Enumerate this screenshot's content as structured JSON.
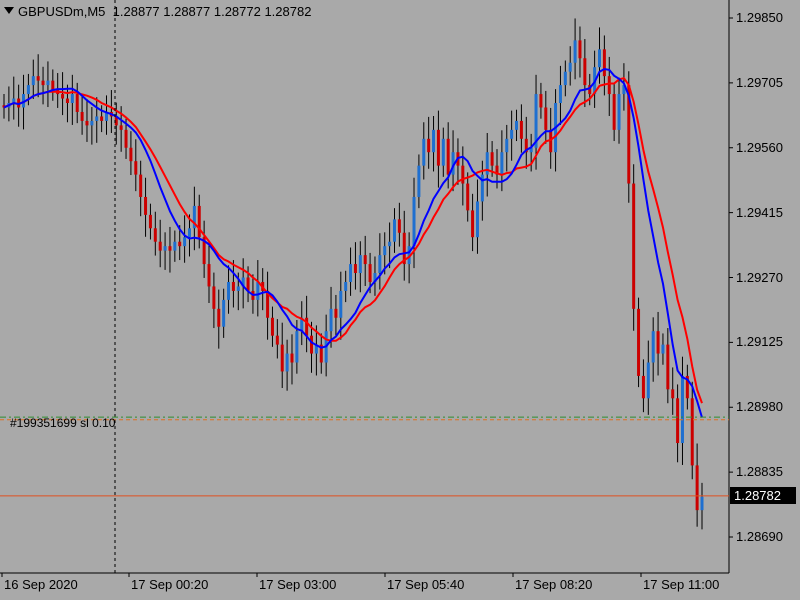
{
  "header": {
    "symbol": "GBPUSDm,M5",
    "ohlc": "1.28877 1.28877 1.28772 1.28782"
  },
  "order_label": "#199351699 sl 0.10",
  "order_label_shadow": "#199351699 sl",
  "current_price": "1.28782",
  "colors": {
    "background": "#a9a9a9",
    "bull_candle": "#1e6fd0",
    "bear_candle": "#cc0000",
    "wick": "#000000",
    "ma_fast": "#0000ff",
    "ma_slow": "#ff0000",
    "order_line_green": "#2f8f2f",
    "order_line_orange": "#e07020",
    "bid_line": "#e05020"
  },
  "chart_data": {
    "type": "candlestick",
    "title": "GBPUSDm,M5",
    "price_ticks": [
      "1.29850",
      "1.29705",
      "1.29560",
      "1.29415",
      "1.29270",
      "1.29125",
      "1.28980",
      "1.28835",
      "1.28690"
    ],
    "time_ticks": [
      "16 Sep 2020",
      "17 Sep 00:20",
      "17 Sep 03:00",
      "17 Sep 05:40",
      "17 Sep 08:20",
      "17 Sep 11:00"
    ],
    "ylim": [
      1.2862,
      1.299
    ],
    "grid": false,
    "close_path": [
      1.2965,
      1.2966,
      1.2967,
      1.2965,
      1.2968,
      1.297,
      1.2972,
      1.2971,
      1.297,
      1.2971,
      1.2969,
      1.2968,
      1.2967,
      1.2966,
      1.2968,
      1.2964,
      1.2962,
      1.2961,
      1.2962,
      1.2963,
      1.2962,
      1.2964,
      1.2963,
      1.2961,
      1.296,
      1.2956,
      1.2953,
      1.295,
      1.2945,
      1.2941,
      1.2938,
      1.2935,
      1.2933,
      1.2934,
      1.2933,
      1.2935,
      1.2934,
      1.2936,
      1.2938,
      1.2943,
      1.2936,
      1.293,
      1.2925,
      1.292,
      1.2916,
      1.2922,
      1.2926,
      1.2924,
      1.2925,
      1.2927,
      1.2924,
      1.2922,
      1.2926,
      1.2924,
      1.2918,
      1.2914,
      1.2912,
      1.2906,
      1.291,
      1.2908,
      1.2915,
      1.2918,
      1.2914,
      1.291,
      1.2912,
      1.2908,
      1.2915,
      1.292,
      1.2918,
      1.2924,
      1.2926,
      1.293,
      1.2928,
      1.2932,
      1.293,
      1.2926,
      1.2928,
      1.2932,
      1.2934,
      1.2935,
      1.294,
      1.2937,
      1.293,
      1.2934,
      1.2945,
      1.2952,
      1.2958,
      1.2955,
      1.296,
      1.2952,
      1.2958,
      1.295,
      1.2955,
      1.2952,
      1.2948,
      1.2942,
      1.2936,
      1.2944,
      1.295,
      1.2955,
      1.2952,
      1.295,
      1.2955,
      1.2958,
      1.296,
      1.2962,
      1.2958,
      1.2955,
      1.2956,
      1.2968,
      1.2965,
      1.296,
      1.2955,
      1.2966,
      1.297,
      1.2973,
      1.2975,
      1.298,
      1.2976,
      1.297,
      1.2968,
      1.2974,
      1.2978,
      1.2972,
      1.2968,
      1.296,
      1.2968,
      1.297,
      1.2948,
      1.292,
      1.2905,
      1.29,
      1.2908,
      1.2915,
      1.291,
      1.2912,
      1.2902,
      1.29,
      1.289,
      1.2905,
      1.29,
      1.2885,
      1.2875,
      1.2878
    ],
    "current_price": 1.28782,
    "order_price_levels": [
      1.28958,
      1.28952
    ],
    "vline_time_label": "17 Sep 00:20"
  }
}
